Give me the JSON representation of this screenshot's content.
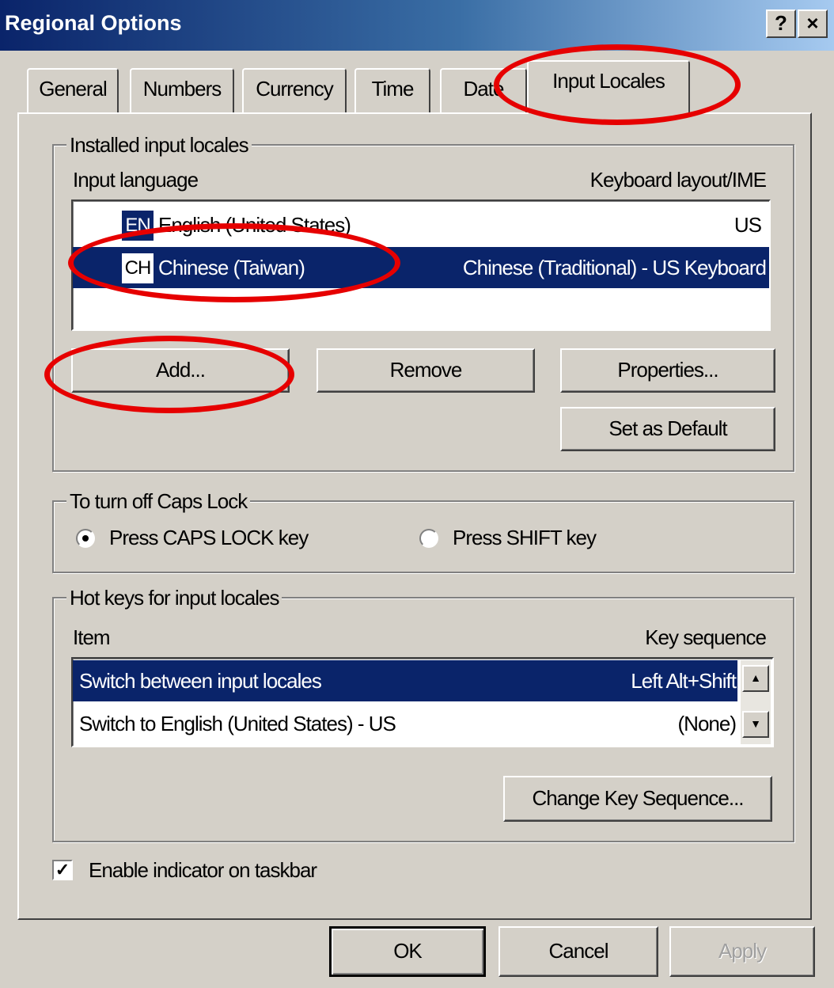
{
  "window": {
    "title": "Regional Options",
    "help_button": "?",
    "close_button": "×"
  },
  "tabs": [
    {
      "label": "General",
      "active": false
    },
    {
      "label": "Numbers",
      "active": false
    },
    {
      "label": "Currency",
      "active": false
    },
    {
      "label": "Time",
      "active": false
    },
    {
      "label": "Date",
      "active": false
    },
    {
      "label": "Input Locales",
      "active": true
    }
  ],
  "installed": {
    "legend": "Installed input locales",
    "col_language": "Input language",
    "col_layout": "Keyboard layout/IME",
    "rows": [
      {
        "badge": "EN",
        "language": "English (United States)",
        "layout": "US",
        "selected": false
      },
      {
        "badge": "CH",
        "language": "Chinese (Taiwan)",
        "layout": "Chinese (Traditional) - US Keyboard",
        "selected": true
      }
    ],
    "buttons": {
      "add": "Add...",
      "remove": "Remove",
      "properties": "Properties...",
      "set_default": "Set as Default"
    }
  },
  "caps": {
    "legend": "To turn off Caps Lock",
    "option1": "Press CAPS LOCK key",
    "option2": "Press SHIFT key",
    "selected": "option1"
  },
  "hotkeys": {
    "legend": "Hot keys for input locales",
    "col_item": "Item",
    "col_sequence": "Key sequence",
    "rows": [
      {
        "item": "Switch between input locales",
        "sequence": "Left Alt+Shift",
        "selected": true
      },
      {
        "item": "Switch to English (United States) - US",
        "sequence": "(None)",
        "selected": false
      }
    ],
    "change_button": "Change Key Sequence..."
  },
  "taskbar": {
    "label": "Enable indicator on taskbar",
    "checked": true
  },
  "footer": {
    "ok": "OK",
    "cancel": "Cancel",
    "apply": "Apply"
  },
  "colors": {
    "selection": "#0a246a",
    "annotation": "#e60000"
  }
}
